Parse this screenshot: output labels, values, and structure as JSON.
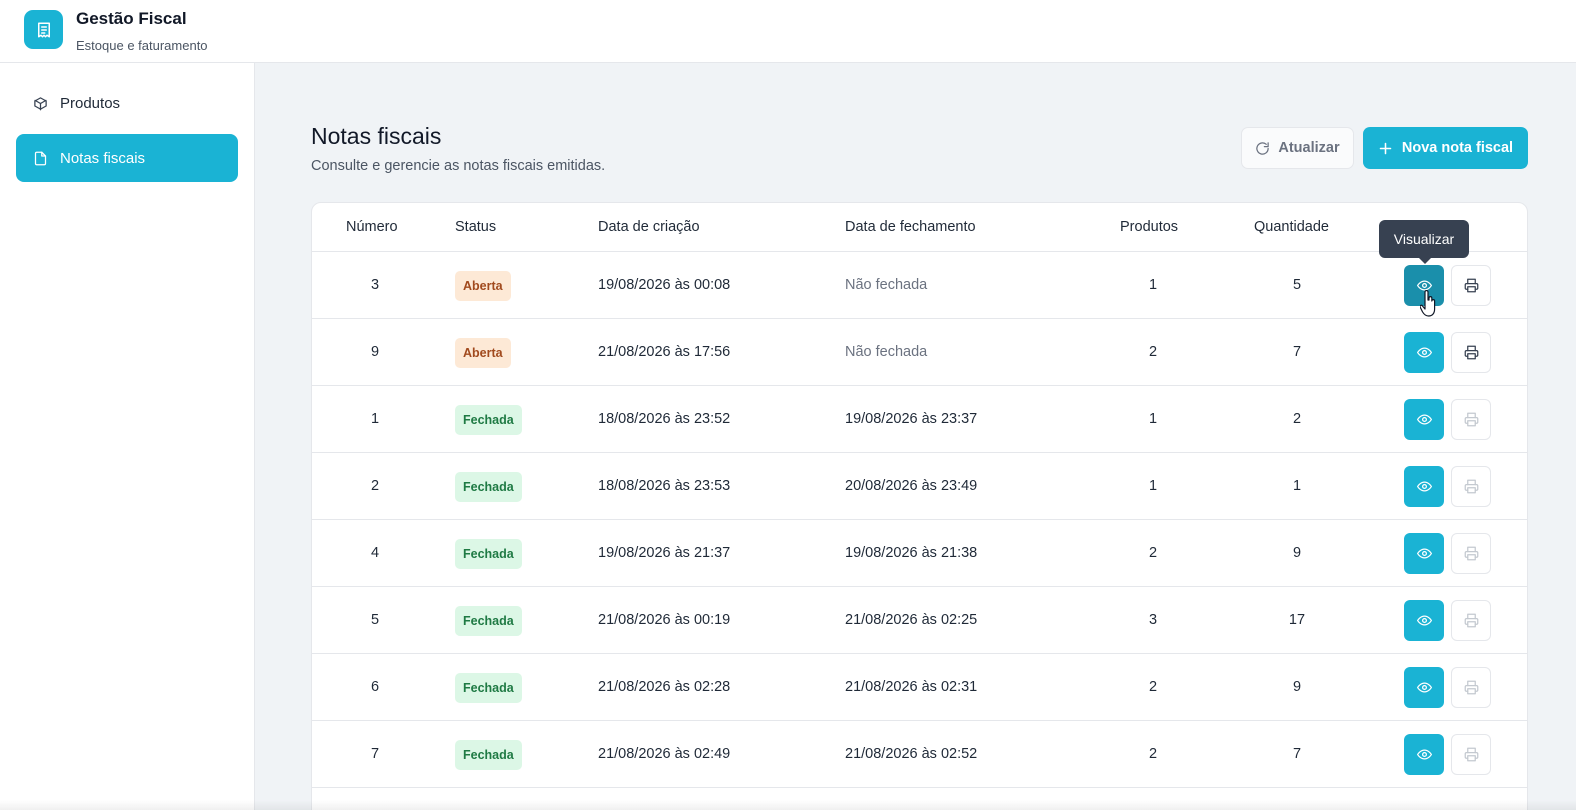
{
  "app": {
    "title": "Gestão Fiscal",
    "subtitle": "Estoque e faturamento",
    "logo_icon": "receipt-icon"
  },
  "sidebar": {
    "items": [
      {
        "label": "Produtos",
        "icon": "box-icon",
        "active": false
      },
      {
        "label": "Notas fiscais",
        "icon": "document-icon",
        "active": true
      }
    ]
  },
  "page": {
    "title": "Notas fiscais",
    "subtitle": "Consulte e gerencie as notas fiscais emitidas.",
    "refresh_label": "Atualizar",
    "new_label": "Nova nota fiscal"
  },
  "table": {
    "headers": [
      "Número",
      "Status",
      "Data de criação",
      "Data de fechamento",
      "Produtos",
      "Quantidade"
    ],
    "rows": [
      {
        "numero": "3",
        "status": "Aberta",
        "status_type": "open",
        "criacao": "19/08/2026 às 00:08",
        "fechamento": "Não fechada",
        "produtos": "1",
        "quantidade": "5"
      },
      {
        "numero": "9",
        "status": "Aberta",
        "status_type": "open",
        "criacao": "21/08/2026 às 17:56",
        "fechamento": "Não fechada",
        "produtos": "2",
        "quantidade": "7"
      },
      {
        "numero": "1",
        "status": "Fechada",
        "status_type": "closed",
        "criacao": "18/08/2026 às 23:52",
        "fechamento": "19/08/2026 às 23:37",
        "produtos": "1",
        "quantidade": "2"
      },
      {
        "numero": "2",
        "status": "Fechada",
        "status_type": "closed",
        "criacao": "18/08/2026 às 23:53",
        "fechamento": "20/08/2026 às 23:49",
        "produtos": "1",
        "quantidade": "1"
      },
      {
        "numero": "4",
        "status": "Fechada",
        "status_type": "closed",
        "criacao": "19/08/2026 às 21:37",
        "fechamento": "19/08/2026 às 21:38",
        "produtos": "2",
        "quantidade": "9"
      },
      {
        "numero": "5",
        "status": "Fechada",
        "status_type": "closed",
        "criacao": "21/08/2026 às 00:19",
        "fechamento": "21/08/2026 às 02:25",
        "produtos": "3",
        "quantidade": "17"
      },
      {
        "numero": "6",
        "status": "Fechada",
        "status_type": "closed",
        "criacao": "21/08/2026 às 02:28",
        "fechamento": "21/08/2026 às 02:31",
        "produtos": "2",
        "quantidade": "9"
      },
      {
        "numero": "7",
        "status": "Fechada",
        "status_type": "closed",
        "criacao": "21/08/2026 às 02:49",
        "fechamento": "21/08/2026 às 02:52",
        "produtos": "2",
        "quantidade": "7"
      }
    ]
  },
  "tooltip": {
    "label": "Visualizar"
  },
  "colors": {
    "accent": "#1ab3d4",
    "accent_hover": "#1a8fab",
    "open_bg": "#fde9d6",
    "open_fg": "#a14a1e",
    "closed_bg": "#dcf7e6",
    "closed_fg": "#1f7a44"
  }
}
